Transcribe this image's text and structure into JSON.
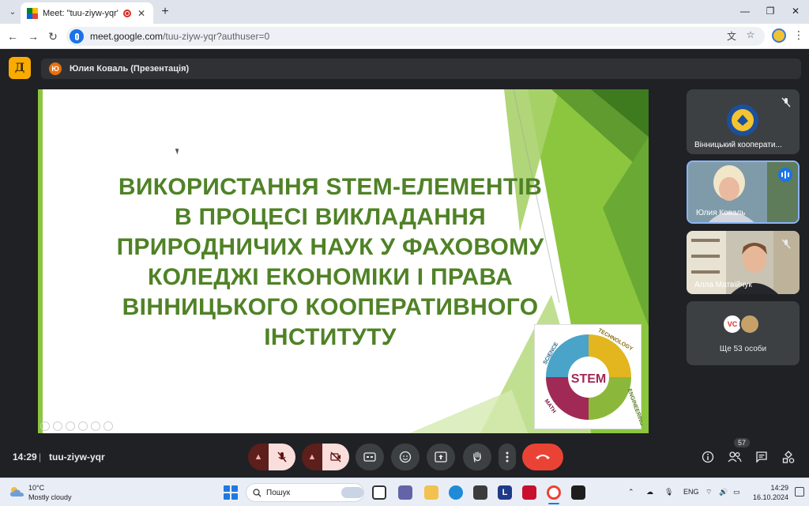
{
  "browser": {
    "tab_title": "Meet: \"tuu-ziyw-yqr\"",
    "new_tab": "+",
    "url_host": "meet.google.com",
    "url_path": "/tuu-ziyw-yqr?authuser=0",
    "window_controls": [
      "minimize-icon",
      "restore-icon",
      "close-icon"
    ]
  },
  "meet": {
    "app_logo": "Д",
    "presenter_initial": "Ю",
    "presenter_label": "Юлия Коваль (Презентація)",
    "slide": {
      "title_lines": [
        "ВИКОРИСТАННЯ STEM-ЕЛЕМЕНТІВ",
        "В ПРОЦЕСІ ВИКЛАДАННЯ",
        "ПРИРОДНИЧИХ НАУК У ФАХОВОМУ",
        "КОЛЕДЖІ ЕКОНОМІКИ І ПРАВА",
        "ВІННИЦЬКОГО КООПЕРАТИВНОГО",
        "ІНСТИТУТУ"
      ],
      "logo": {
        "center": "STEM",
        "science": "SCIENCE",
        "technology": "TECHNOLOGY",
        "engineering": "ENGINEERING",
        "math": "MATH"
      },
      "accent_color": "#4f8226"
    },
    "participants": [
      {
        "name": "Вінницький кооперати...",
        "muted": true
      },
      {
        "name": "Юлия Коваль",
        "speaking": true
      },
      {
        "name": "Алла Матвійчук",
        "muted": true
      }
    ],
    "more_people": {
      "label": "Ще 53 особи",
      "avatar_text": "VC"
    },
    "bottom": {
      "time": "14:29",
      "separator": "|",
      "meeting_code": "tuu-ziyw-yqr",
      "people_count": "57"
    }
  },
  "taskbar": {
    "temperature": "10°C",
    "weather": "Mostly cloudy",
    "search_label": "Пошук",
    "language": "ENG",
    "time": "14:29",
    "date": "16.10.2024"
  }
}
